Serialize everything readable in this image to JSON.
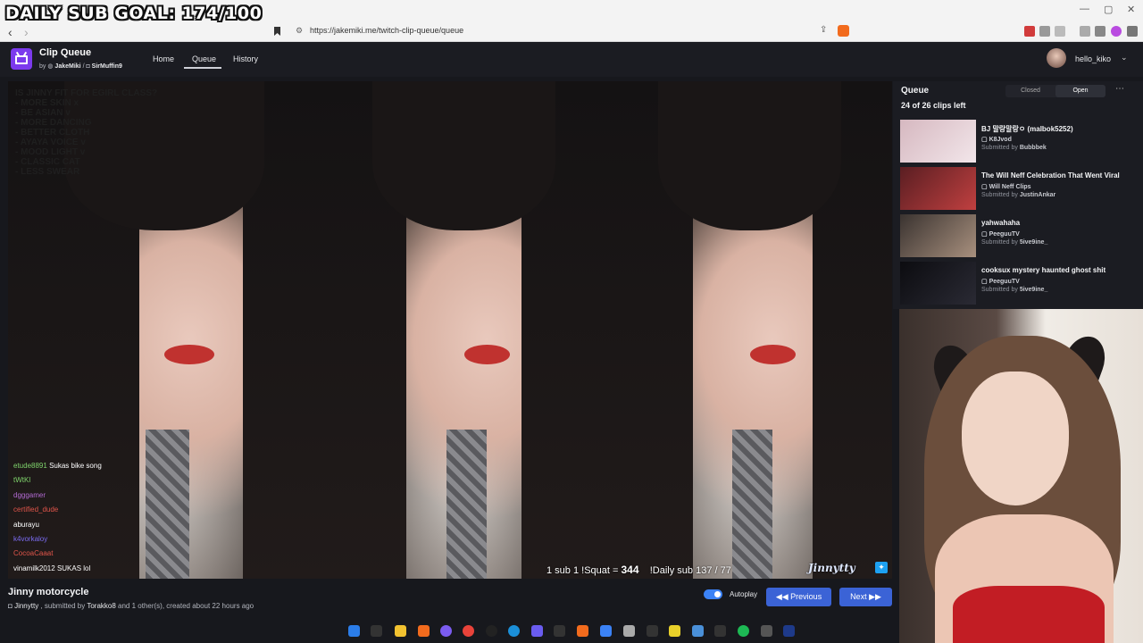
{
  "overlay": {
    "daily_goal": "DAILY SUB GOAL: 174/100"
  },
  "browser": {
    "url": "https://jakemiki.me/twitch-clip-queue/queue"
  },
  "app": {
    "title": "Clip Queue",
    "by_prefix": "by",
    "author1": "JakeMiki",
    "sep": "/",
    "author2": "SirMuffin9",
    "nav": [
      "Home",
      "Queue",
      "History"
    ],
    "active_nav": "Queue",
    "user": "hello_kiko"
  },
  "video": {
    "overlay_list": "IS JINNY FIT FOR EGIRL CLASS?\n- MORE SKIN x\n- BE ASIAN v\n- MORE DANCING\n- BETTER CLOTH\n- AYAYA VOICE v\n- MOOD LIGHT v\n- CLASSIC CAT\n- LESS SWEAR",
    "chat": [
      {
        "name": "etude8891",
        "msg": "Sukas bike song"
      },
      {
        "name": "tWtKl",
        "msg": ""
      },
      {
        "name": "dgggamer",
        "msg": ""
      },
      {
        "name": "certified_dude",
        "msg": ""
      },
      {
        "name": "aburayu",
        "msg": ""
      },
      {
        "name": "k4vorkaloy",
        "msg": ""
      },
      {
        "name": "CocoaCaaat",
        "msg": ""
      },
      {
        "name": "vinamilk2012",
        "msg": "SUKAS lol"
      }
    ],
    "stat1": "1 sub 1 !Squat =",
    "stat1_val": "344",
    "stat2": "!Daily sub",
    "stat2_val": "137 / 77",
    "watermark": "Jinnytty"
  },
  "clip": {
    "title": "Jinny motorcycle",
    "channel": "Jinnytty",
    "submitted_prefix": ", submitted by",
    "submitter": "Torakko8",
    "others": "and 1 other(s), created about 22 hours ago"
  },
  "controls": {
    "autoplay": "Autoplay",
    "previous": "Previous",
    "next": "Next"
  },
  "queue": {
    "title": "Queue",
    "closed": "Closed",
    "open": "Open",
    "count": "24 of 26 clips left",
    "items": [
      {
        "title": "BJ 말랑말랑ㅇ (malbok5252)",
        "channel": "K8Jvod",
        "submitted_by": "Submitted by",
        "submitter": "Bubbbek",
        "thumb": [
          "#d6b8c0",
          "#f2e6ea"
        ]
      },
      {
        "title": "The Will Neff Celebration That Went Viral",
        "channel": "Will Neff Clips",
        "submitted_by": "Submitted by",
        "submitter": "JustinAnkar",
        "thumb": [
          "#5a1e22",
          "#c04040"
        ]
      },
      {
        "title": "yahwahaha",
        "channel": "PeeguuTV",
        "submitted_by": "Submitted by",
        "submitter": "5ive9ine_",
        "thumb": [
          "#3a3330",
          "#a8907e"
        ]
      },
      {
        "title": "cooksux mystery haunted ghost shit",
        "channel": "PeeguuTV",
        "submitted_by": "Submitted by",
        "submitter": "5ive9ine_",
        "thumb": [
          "#0c0c10",
          "#2a2a34"
        ]
      }
    ]
  },
  "colors": {
    "accent": "#3b63d6",
    "brand": "#7c3aed",
    "bg": "#17181d"
  }
}
